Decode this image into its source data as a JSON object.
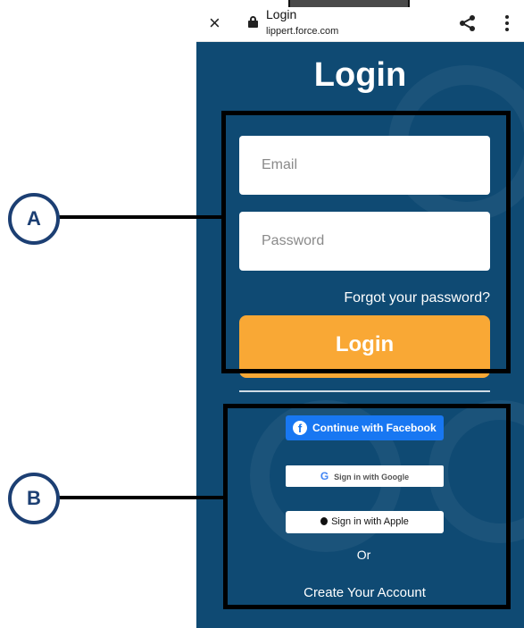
{
  "browser": {
    "title": "Login",
    "host": "lippert.force.com",
    "close_icon": "×"
  },
  "page": {
    "heading": "Login",
    "email_placeholder": "Email",
    "password_placeholder": "Password",
    "forgot_link": "Forgot your password?",
    "login_button": "Login"
  },
  "social": {
    "facebook": "Continue with Facebook",
    "google": "Sign in with Google",
    "apple": "Sign in with Apple",
    "or_text": "Or",
    "create_account": "Create Your Account"
  },
  "callouts": {
    "a": "A",
    "b": "B"
  },
  "colors": {
    "background": "#0f4a73",
    "login_button": "#f9a835",
    "facebook": "#1877f2",
    "callout": "#1c3f73"
  }
}
